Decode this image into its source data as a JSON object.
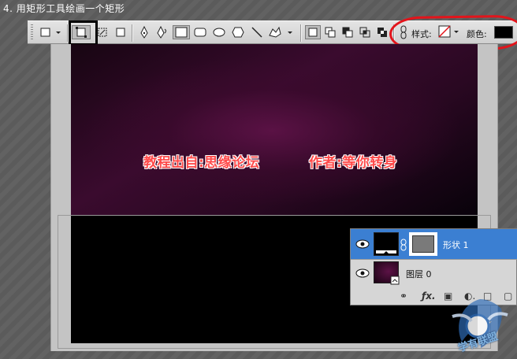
{
  "step_title": "4. 用矩形工具绘画一个矩形",
  "toolbar": {
    "style_label": "样式:",
    "color_label": "颜色:",
    "color_value": "#000000",
    "highlight_color": "#e3141b"
  },
  "canvas": {
    "credit_left": "教程出自:思缘论坛",
    "credit_right": "作者:等你转身",
    "credit_color": "#ff4a4a"
  },
  "layers": {
    "rows": [
      {
        "name": "形状 1",
        "selected": true
      },
      {
        "name": "图层 0",
        "selected": false
      }
    ],
    "selected_color": "#3b7fd2"
  },
  "icons": [
    "rectangle-tool-icon",
    "shape-layers-icon",
    "paths-icon",
    "fill-pixels-icon",
    "pen-icon",
    "freeform-pen-icon",
    "rectangle-shape-icon",
    "rounded-rectangle-icon",
    "ellipse-icon",
    "polygon-icon",
    "line-icon",
    "custom-shape-icon",
    "chain-link-icon",
    "eye-icon",
    "fx-icon",
    "mask-icon",
    "adjustment-icon",
    "new-layer-icon"
  ],
  "watermark_text": "学有联盟"
}
